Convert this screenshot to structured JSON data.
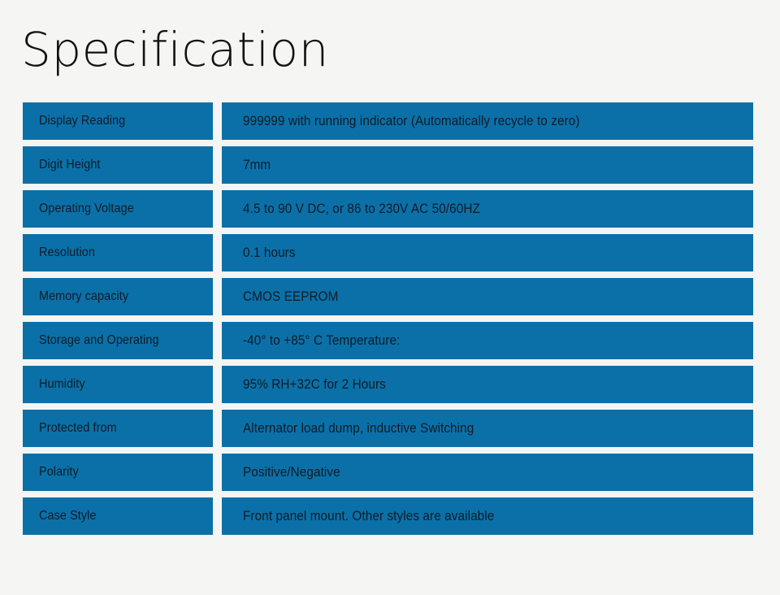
{
  "page": {
    "title": "Specification",
    "background_color": "#f5f5f3",
    "accent_color": "#0c70a8",
    "text_color": "#0d1b26"
  },
  "spec_table": {
    "rows": [
      {
        "label": "Display Reading",
        "value": "999999 with running indicator (Automatically recycle to zero)"
      },
      {
        "label": "Digit Height",
        "value": "7mm"
      },
      {
        "label": "Operating Voltage",
        "value": "4.5 to 90 V DC, or 86 to 230V AC 50/60HZ"
      },
      {
        "label": "Resolution",
        "value": "0.1 hours"
      },
      {
        "label": "Memory capacity",
        "value": "CMOS EEPROM"
      },
      {
        "label": "Storage and Operating",
        "value": "-40° to +85° C Temperature:"
      },
      {
        "label": "Humidity",
        "value": "95% RH+32C for 2 Hours"
      },
      {
        "label": "Protected from",
        "value": "Alternator load dump, inductive Switching"
      },
      {
        "label": "Polarity",
        "value": "Positive/Negative"
      },
      {
        "label": "Case Style",
        "value": "Front panel mount. Other styles are available"
      }
    ]
  }
}
